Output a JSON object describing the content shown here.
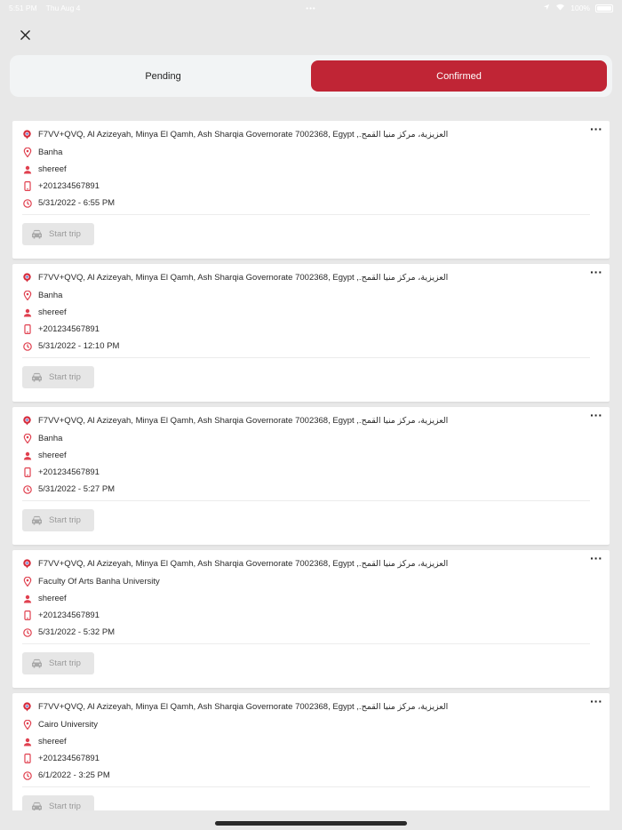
{
  "status_bar": {
    "time": "5:51 PM",
    "date": "Thu Aug 4",
    "dots": "•••",
    "battery": "100%"
  },
  "tabs": [
    {
      "label": "Pending",
      "active": false
    },
    {
      "label": "Confirmed",
      "active": true
    }
  ],
  "colors": {
    "accent": "#c02535",
    "background": "#e8e8e8",
    "card": "#ffffff"
  },
  "trips": [
    {
      "pickup": "F7VV+QVQ, Al Azizeyah, Minya El Qamh, Ash Sharqia Governorate 7002368, Egypt ,.العزيزية، مركز منيا القمح",
      "destination": "Banha",
      "name": "shereef",
      "phone": "+201234567891",
      "datetime": "5/31/2022 - 6:55 PM",
      "button": "Start trip"
    },
    {
      "pickup": "F7VV+QVQ, Al Azizeyah, Minya El Qamh, Ash Sharqia Governorate 7002368, Egypt ,.العزيزية، مركز منيا القمح",
      "destination": "Banha",
      "name": "shereef",
      "phone": "+201234567891",
      "datetime": "5/31/2022 - 12:10 PM",
      "button": "Start trip"
    },
    {
      "pickup": "F7VV+QVQ, Al Azizeyah, Minya El Qamh, Ash Sharqia Governorate 7002368, Egypt ,.العزيزية، مركز منيا القمح",
      "destination": "Banha",
      "name": "shereef",
      "phone": "+201234567891",
      "datetime": "5/31/2022 - 5:27 PM",
      "button": "Start trip"
    },
    {
      "pickup": "F7VV+QVQ, Al Azizeyah, Minya El Qamh, Ash Sharqia Governorate 7002368, Egypt ,.العزيزية، مركز منيا القمح",
      "destination": "Faculty Of Arts Banha University",
      "name": "shereef",
      "phone": "+201234567891",
      "datetime": "5/31/2022 - 5:32 PM",
      "button": "Start trip"
    },
    {
      "pickup": "F7VV+QVQ, Al Azizeyah, Minya El Qamh, Ash Sharqia Governorate 7002368, Egypt ,.العزيزية، مركز منيا القمح",
      "destination": "Cairo University",
      "name": "shereef",
      "phone": "+201234567891",
      "datetime": "6/1/2022 - 3:25 PM",
      "button": "Start trip"
    }
  ],
  "icons": {
    "close": "close-icon",
    "more": "more-options-icon",
    "pickup": "pickup-marker-icon",
    "destination": "location-pin-icon",
    "person": "person-icon",
    "phone": "phone-icon",
    "time": "clock-icon",
    "car": "car-icon"
  }
}
